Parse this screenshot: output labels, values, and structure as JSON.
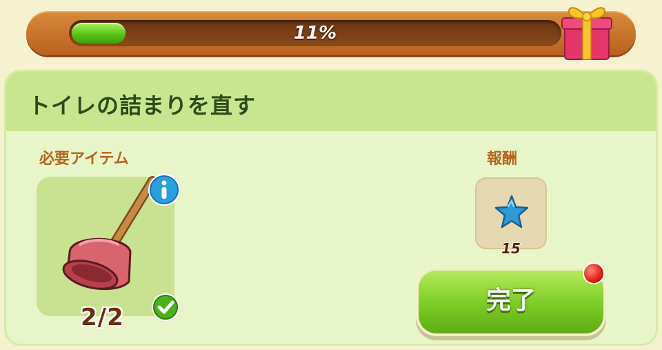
{
  "progress": {
    "percent_text": "11%",
    "fraction": 0.11,
    "fill_color": "#52c112"
  },
  "quest": {
    "title": "トイレの詰まりを直す"
  },
  "required": {
    "label": "必要アイテム",
    "item_icon": "plunger-icon",
    "count_text": "2/2"
  },
  "reward": {
    "label": "報酬",
    "icon": "blue-star-icon",
    "value": "15"
  },
  "complete_button": {
    "label": "完了"
  }
}
